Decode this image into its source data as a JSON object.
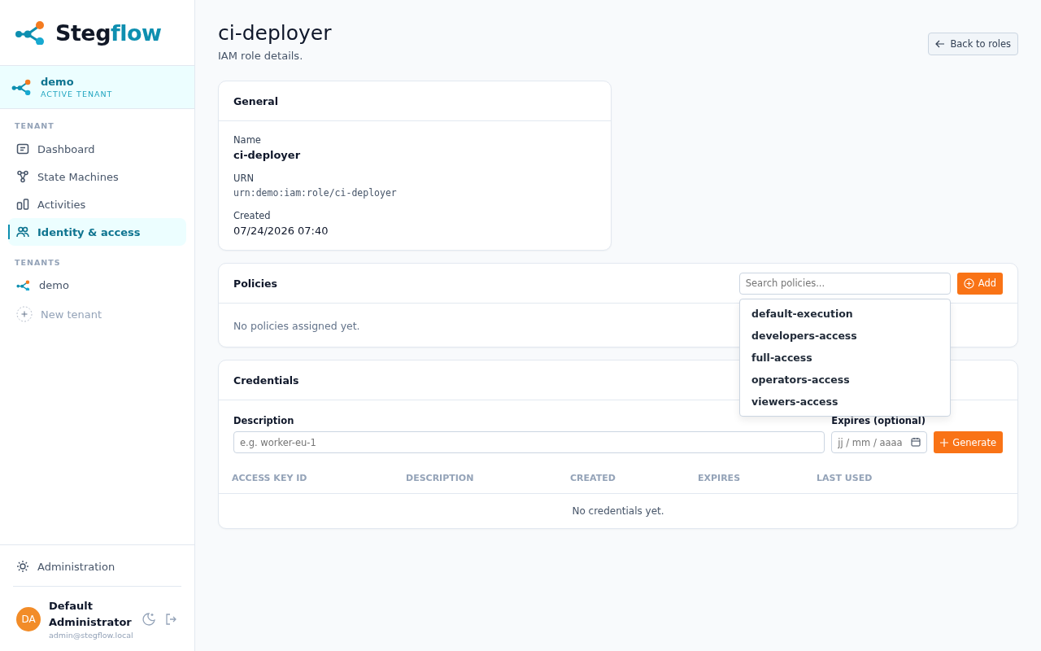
{
  "sidebar": {
    "brand": {
      "part1": "Steg",
      "part2": "flow"
    },
    "active_tenant": {
      "name": "demo",
      "caption": "ACTIVE TENANT"
    },
    "sections": [
      {
        "heading": "TENANT",
        "items": [
          {
            "label": "Dashboard",
            "kind": "dashboard",
            "selected": false
          },
          {
            "label": "State Machines",
            "kind": "nodes",
            "selected": false
          },
          {
            "label": "Activities",
            "kind": "bars",
            "selected": false
          },
          {
            "label": "Identity & access",
            "kind": "users",
            "selected": true
          }
        ]
      },
      {
        "heading": "TENANTS",
        "items": [
          {
            "label": "demo",
            "kind": "tenant",
            "selected": false
          },
          {
            "label": "New tenant",
            "kind": "plus",
            "selected": false
          }
        ]
      }
    ],
    "admin": {
      "label": "Administration"
    },
    "user": {
      "initials": "DA",
      "name": "Default Administrator",
      "email": "admin@stegflow.local"
    }
  },
  "header": {
    "title": "ci-deployer",
    "subtitle": "IAM role details.",
    "back_button": "Back to roles"
  },
  "general": {
    "title": "General",
    "fields": [
      {
        "label": "Name",
        "value": "ci-deployer",
        "kind": "bold"
      },
      {
        "label": "URN",
        "value": "urn:demo:iam:role/ci-deployer",
        "kind": "mono"
      },
      {
        "label": "Created",
        "value": "07/24/2026 07:40",
        "kind": "plain"
      }
    ]
  },
  "policies": {
    "title": "Policies",
    "search": {
      "placeholder": "Search policies..."
    },
    "add_button": "Add",
    "empty": "No policies assigned yet.",
    "dropdown": [
      "default-execution",
      "developers-access",
      "full-access",
      "operators-access",
      "viewers-access"
    ]
  },
  "credentials": {
    "title": "Credentials",
    "description_label": "Description",
    "description": {
      "placeholder": "e.g. worker-eu-1"
    },
    "expires_label": "Expires (optional)",
    "expires": {
      "placeholder": "jj / mm / aaaa"
    },
    "generate_button": "Generate",
    "table": {
      "columns": [
        "ACCESS KEY ID",
        "DESCRIPTION",
        "CREATED",
        "EXPIRES",
        "LAST USED"
      ],
      "empty": "No credentials yet."
    }
  }
}
